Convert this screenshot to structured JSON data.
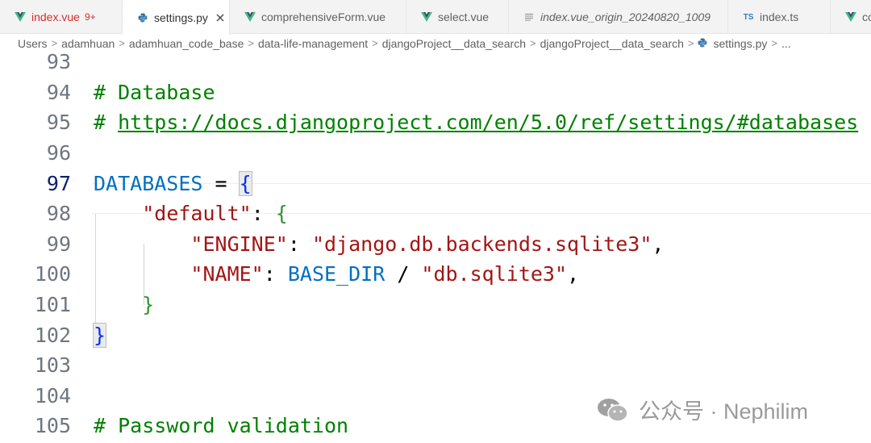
{
  "tabs": [
    {
      "label": "index.vue",
      "badge": "9+",
      "icon": "vue-icon",
      "error": true
    },
    {
      "label": "settings.py",
      "icon": "python-icon",
      "active": true
    },
    {
      "label": "comprehensiveForm.vue",
      "icon": "vue-icon"
    },
    {
      "label": "select.vue",
      "icon": "vue-icon"
    },
    {
      "label": "index.vue_origin_20240820_1009",
      "icon": "file-lines-icon"
    },
    {
      "label": "index.ts",
      "icon": "typescript-icon",
      "icon_text": "TS"
    },
    {
      "label": "co",
      "icon": "vue-icon"
    }
  ],
  "breadcrumb": {
    "items": [
      "Users",
      "adamhuan",
      "adamhuan_code_base",
      "data-life-management",
      "djangoProject__data_search",
      "djangoProject__data_search",
      "settings.py",
      "..."
    ],
    "separator": ">"
  },
  "editor": {
    "lines": [
      {
        "n": "93"
      },
      {
        "n": "94",
        "comment": "# Database"
      },
      {
        "n": "95",
        "hash": "# ",
        "url": "https://docs.djangoproject.com/en/5.0/ref/settings/#databases"
      },
      {
        "n": "96"
      },
      {
        "n": "97",
        "name": "DATABASES",
        "eq": " = ",
        "open": "{"
      },
      {
        "n": "98",
        "key": "\"default\"",
        "colon": ": ",
        "open": "{"
      },
      {
        "n": "99",
        "key": "\"ENGINE\"",
        "colon": ": ",
        "value": "\"django.db.backends.sqlite3\"",
        "comma": ","
      },
      {
        "n": "100",
        "key": "\"NAME\"",
        "colon": ": ",
        "name": "BASE_DIR",
        "slash": " / ",
        "value": "\"db.sqlite3\"",
        "comma": ","
      },
      {
        "n": "101",
        "close": "}"
      },
      {
        "n": "102",
        "close": "}"
      },
      {
        "n": "103"
      },
      {
        "n": "104"
      },
      {
        "n": "105",
        "comment": "# Password validation"
      }
    ],
    "current_line": "97"
  },
  "watermark": {
    "text": "公众号 · Nephilim"
  },
  "colors": {
    "comment": "#008000",
    "string": "#a31515",
    "variable": "#0070c1",
    "bracket_level1": "#0431fa",
    "bracket_level2": "#319331",
    "vue": "#41b883",
    "python": "#3572a5",
    "error": "#d32f2f"
  }
}
